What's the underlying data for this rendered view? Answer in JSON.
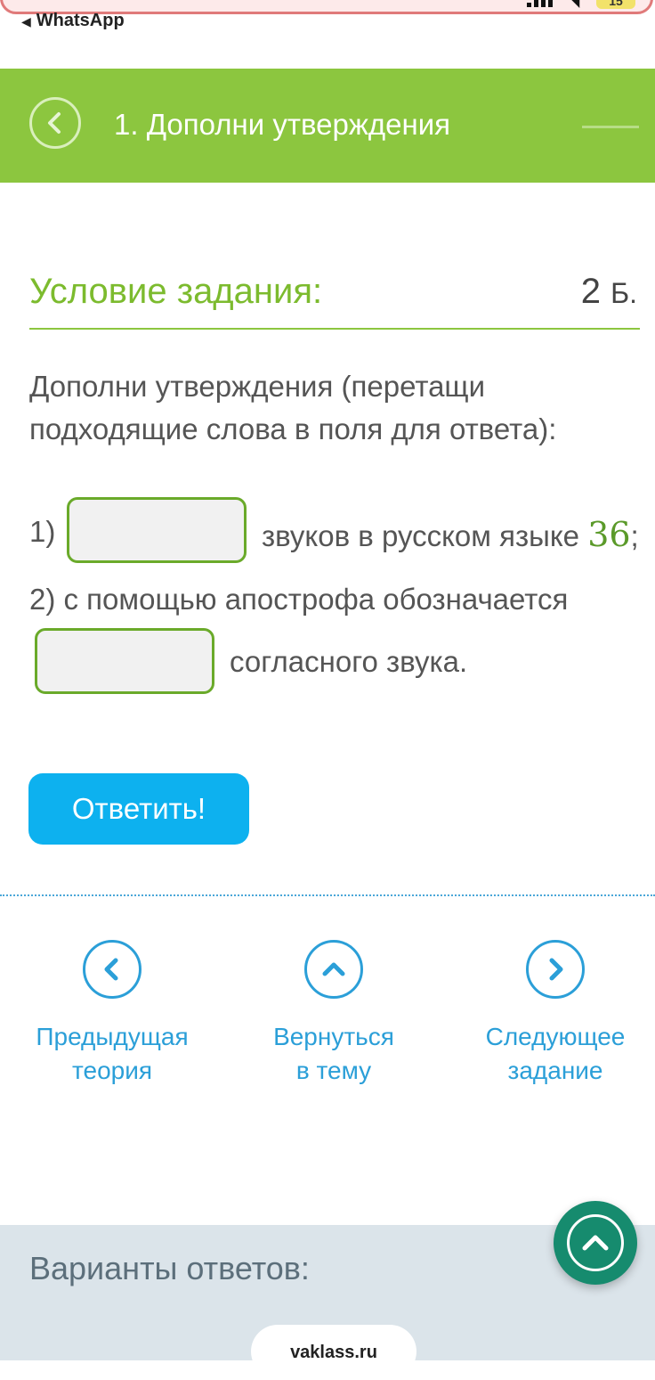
{
  "status_bar": {
    "back_app": "WhatsApp",
    "battery": "15"
  },
  "header": {
    "title": "1. Дополни утверждения"
  },
  "condition": {
    "title": "Условие задания:",
    "points_value": "2",
    "points_unit": "Б."
  },
  "task": {
    "instruction": "Дополни утверждения (перетащи подходящие слова в поля для ответа):",
    "item1_prefix": "1)",
    "item1_text": "звуков в русском языке",
    "item1_number": "36",
    "item1_end": ";",
    "item2_text": "2) с помощью апострофа обозначается",
    "item2_suffix": "согласного звука."
  },
  "answer_button": "Ответить!",
  "nav": {
    "prev_line1": "Предыдущая",
    "prev_line2": "теория",
    "back_line1": "Вернуться",
    "back_line2": "в тему",
    "next_line1": "Следующее",
    "next_line2": "задание"
  },
  "variants": {
    "title": "Варианты ответов:"
  },
  "browser": {
    "url": "vaklass.ru"
  },
  "colors": {
    "green": "#8cc63f",
    "blue": "#0db1ef",
    "link": "#2b9fd8",
    "scroll_top": "#168b6e"
  },
  "icons": [
    "chevron-left-icon",
    "chevron-up-icon",
    "chevron-right-icon"
  ]
}
